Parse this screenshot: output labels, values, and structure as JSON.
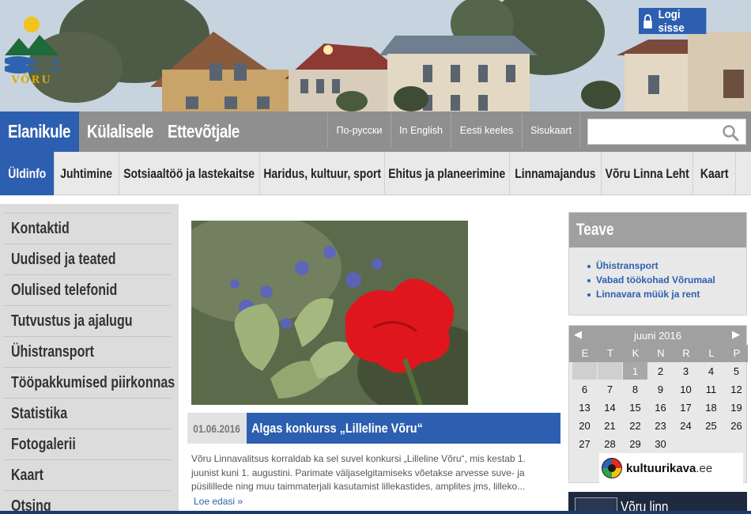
{
  "header": {
    "logo_text": "VÕRU",
    "login_label": "Logi sisse"
  },
  "main_nav": {
    "tabs": [
      {
        "label": "Elanikule"
      },
      {
        "label": "Külalisele"
      },
      {
        "label": "Ettevõtjale"
      }
    ],
    "links": [
      {
        "label": "По-русски"
      },
      {
        "label": "In English"
      },
      {
        "label": "Eesti keeles"
      },
      {
        "label": "Sisukaart"
      }
    ],
    "search": {
      "value": "",
      "placeholder": ""
    }
  },
  "sub_nav": {
    "items": [
      {
        "label": "Üldinfo"
      },
      {
        "label": "Juhtimine"
      },
      {
        "label": "Sotsiaaltöö ja lastekaitse"
      },
      {
        "label": "Haridus, kultuur, sport"
      },
      {
        "label": "Ehitus ja planeerimine"
      },
      {
        "label": "Linnamajandus"
      },
      {
        "label": "Võru Linna Leht"
      },
      {
        "label": "Kaart"
      }
    ]
  },
  "sidebar": {
    "items": [
      {
        "label": "Kontaktid"
      },
      {
        "label": "Uudised ja teated"
      },
      {
        "label": "Olulised telefonid"
      },
      {
        "label": "Tutvustus ja ajalugu"
      },
      {
        "label": "Ühistransport"
      },
      {
        "label": "Tööpakkumised piirkonnas"
      },
      {
        "label": "Statistika"
      },
      {
        "label": "Fotogalerii"
      },
      {
        "label": "Kaart"
      },
      {
        "label": "Otsing"
      }
    ]
  },
  "news": {
    "date": "01.06.2016",
    "title": "Algas konkurss „Lilleline Võru“",
    "body": "Võru Linnavalitsus korraldab ka sel suvel konkursi „Lilleline Võru“, mis kestab 1. juunist kuni 1. augustini. Parimate väljaselgitamiseks võetakse arvesse suve- ja püsililledе ning muu taimmaterjali kasutamist lillekastides, amplites jms, lilleko...",
    "read_more": "Loe edasi »"
  },
  "teave": {
    "title": "Teave",
    "links": [
      {
        "label": "Ühistransport"
      },
      {
        "label": "Vabad töökohad Võrumaal"
      },
      {
        "label": "Linnavara müük ja rent"
      }
    ]
  },
  "calendar": {
    "month": "juuni 2016",
    "prev": "◀",
    "next": "▶",
    "day_names": [
      "E",
      "T",
      "K",
      "N",
      "R",
      "L",
      "P"
    ],
    "leading_empty": 2,
    "today": 1,
    "days": [
      1,
      2,
      3,
      4,
      5,
      6,
      7,
      8,
      9,
      10,
      11,
      12,
      13,
      14,
      15,
      16,
      17,
      18,
      19,
      20,
      21,
      22,
      23,
      24,
      25,
      26,
      27,
      28,
      29,
      30
    ]
  },
  "kultuurikava": {
    "name": "kultuurikava",
    "tld": ".ee"
  },
  "voru_linn": {
    "label": "Võru linn"
  },
  "colors": {
    "accent": "#2d5fb0",
    "nav_gray": "#8f8f8f",
    "sidebar_gray": "#dcdcdc"
  }
}
